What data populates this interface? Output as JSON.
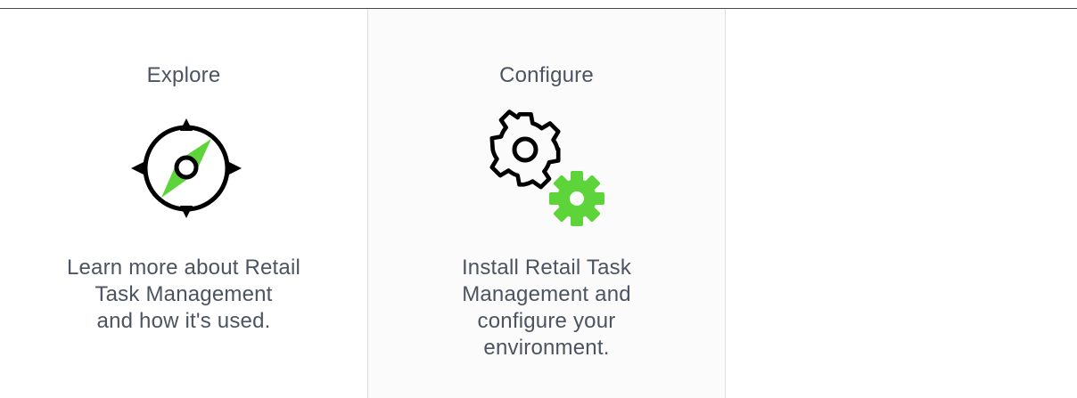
{
  "cards": [
    {
      "title": "Explore",
      "icon": "compass-icon",
      "description_lines": [
        "Learn more about Retail",
        "Task Management",
        "and how it's used."
      ]
    },
    {
      "title": "Configure",
      "icon": "gears-icon",
      "description_lines": [
        "Install Retail Task",
        "Management and",
        "configure your",
        "environment."
      ]
    }
  ],
  "colors": {
    "text": "#4b5460",
    "accent_green": "#5cd43a",
    "icon_stroke": "#000000",
    "divider": "#dedede"
  }
}
